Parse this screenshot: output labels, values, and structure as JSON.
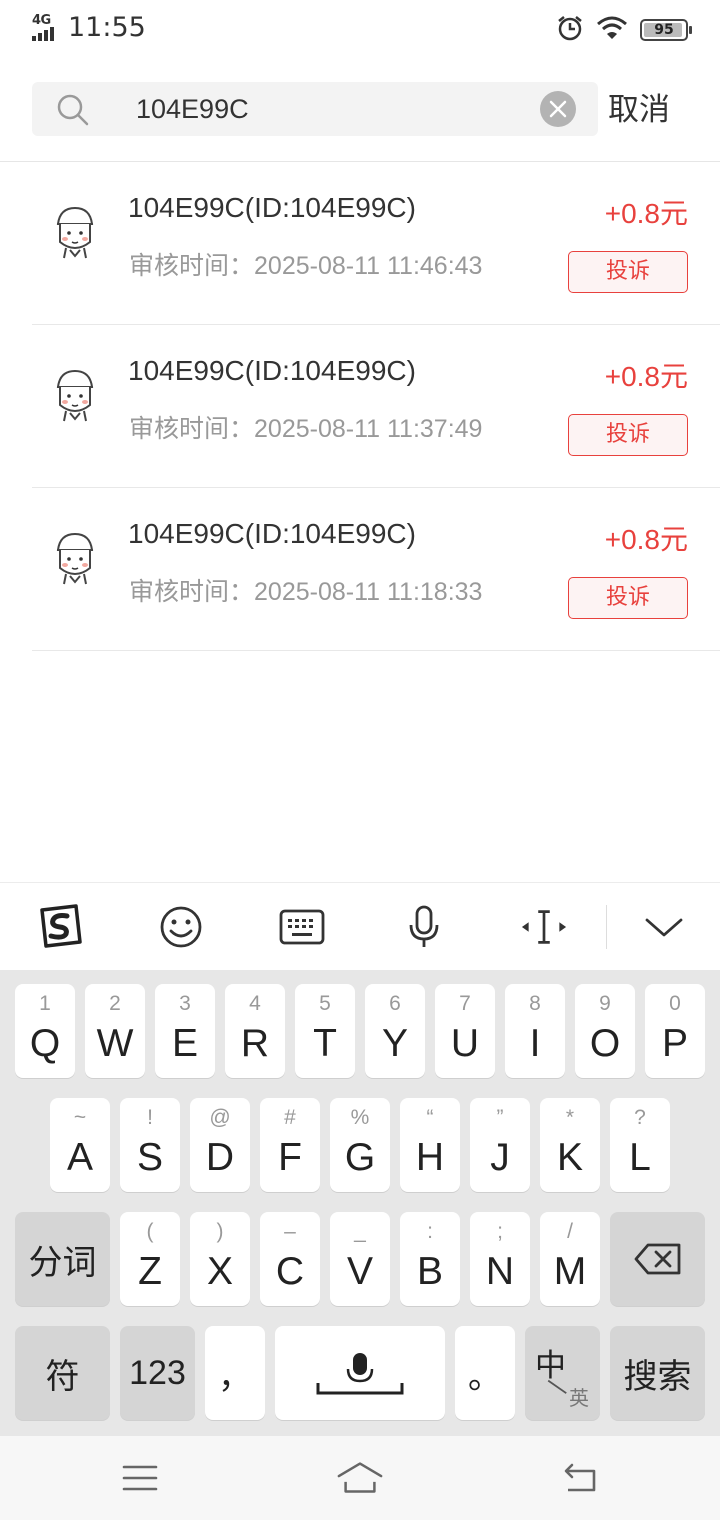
{
  "status_bar": {
    "network": "4G",
    "time": "11:55",
    "battery": "95",
    "battery_level": 0.95,
    "icons": [
      "signal-icon",
      "alarm-icon",
      "wifi-icon",
      "battery-icon"
    ]
  },
  "search": {
    "value": "104E99C",
    "cancel_label": "取消"
  },
  "results": [
    {
      "title": "104E99C(ID:104E99C)",
      "time_label": "审核时间：",
      "time": "2025-08-11 11:46:43",
      "amount": "+0.8元",
      "action": "投诉"
    },
    {
      "title": "104E99C(ID:104E99C)",
      "time_label": "审核时间：",
      "time": "2025-08-11 11:37:49",
      "amount": "+0.8元",
      "action": "投诉"
    },
    {
      "title": "104E99C(ID:104E99C)",
      "time_label": "审核时间：",
      "time": "2025-08-11 11:18:33",
      "amount": "+0.8元",
      "action": "投诉"
    }
  ],
  "keyboard": {
    "toolbar_icons": [
      "sogou-logo-icon",
      "emoji-icon",
      "keyboard-icon",
      "microphone-icon",
      "cursor-move-icon",
      "collapse-keyboard-icon"
    ],
    "row1": [
      {
        "hint": "1",
        "key": "Q"
      },
      {
        "hint": "2",
        "key": "W"
      },
      {
        "hint": "3",
        "key": "E"
      },
      {
        "hint": "4",
        "key": "R"
      },
      {
        "hint": "5",
        "key": "T"
      },
      {
        "hint": "6",
        "key": "Y"
      },
      {
        "hint": "7",
        "key": "U"
      },
      {
        "hint": "8",
        "key": "I"
      },
      {
        "hint": "9",
        "key": "O"
      },
      {
        "hint": "0",
        "key": "P"
      }
    ],
    "row2": [
      {
        "hint": "~",
        "key": "A"
      },
      {
        "hint": "!",
        "key": "S"
      },
      {
        "hint": "@",
        "key": "D"
      },
      {
        "hint": "#",
        "key": "F"
      },
      {
        "hint": "%",
        "key": "G"
      },
      {
        "hint": "“",
        "key": "H"
      },
      {
        "hint": "”",
        "key": "J"
      },
      {
        "hint": "*",
        "key": "K"
      },
      {
        "hint": "?",
        "key": "L"
      }
    ],
    "row3_left": "分词",
    "row3": [
      {
        "hint": "(",
        "key": "Z"
      },
      {
        "hint": ")",
        "key": "X"
      },
      {
        "hint": "–",
        "key": "C"
      },
      {
        "hint": "_",
        "key": "V"
      },
      {
        "hint": ":",
        "key": "B"
      },
      {
        "hint": ";",
        "key": "N"
      },
      {
        "hint": "/",
        "key": "M"
      }
    ],
    "symbols_label": "符",
    "numbers_label": "123",
    "comma": "，",
    "period": "。",
    "lang_main": "中",
    "lang_sub": "英",
    "search_label": "搜索"
  },
  "nav_bar": {
    "icons": [
      "menu-icon",
      "home-icon",
      "back-icon"
    ]
  },
  "colors": {
    "accent_red": "#e8413d",
    "keyboard_bg": "#e7e7e7"
  }
}
